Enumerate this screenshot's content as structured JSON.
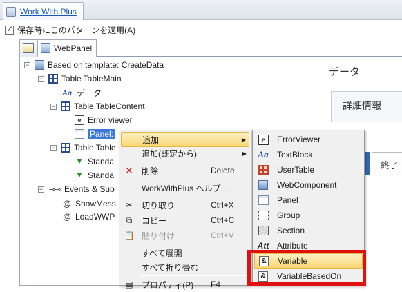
{
  "window": {
    "tab_title": "Work With Plus"
  },
  "option": {
    "label": "保存時にこのパターンを適用(A)",
    "checked": true
  },
  "inner_tabs": {
    "webpanel_label": "WebPanel"
  },
  "tree": [
    {
      "label": "Based on template: CreateData",
      "icon": "webpanel-icon",
      "expander": "−"
    },
    {
      "label": "Table TableMain",
      "icon": "table-icon",
      "expander": "−"
    },
    {
      "label": "データ",
      "icon": "textblock-icon",
      "expander": ""
    },
    {
      "label": "Table TableContent",
      "icon": "table-icon",
      "expander": "−"
    },
    {
      "label": "Error viewer",
      "icon": "errorviewer-icon",
      "expander": ""
    },
    {
      "label": "Panel:",
      "icon": "panel-icon",
      "expander": ""
    },
    {
      "label": "Table Table",
      "icon": "table-icon",
      "expander": "−"
    },
    {
      "label": "Standa",
      "icon": "standard-action-icon",
      "expander": ""
    },
    {
      "label": "Standa",
      "icon": "standard-action-icon",
      "expander": ""
    },
    {
      "label": "Events & Sub",
      "icon": "events-icon",
      "expander": "−"
    },
    {
      "label": "ShowMess",
      "icon": "at-icon",
      "expander": ""
    },
    {
      "label": "LoadWWP",
      "icon": "at-icon",
      "expander": ""
    }
  ],
  "right_panel": {
    "title": "データ",
    "section": "詳細情報",
    "end_button": "終了"
  },
  "context_menu": [
    {
      "label": "追加",
      "shortcut": "",
      "submenu": true,
      "highlighted": true,
      "icon": ""
    },
    {
      "label": "追加(既定から)",
      "shortcut": "",
      "submenu": true,
      "icon": ""
    },
    {
      "label": "削除",
      "shortcut": "Delete",
      "icon": "delete-icon"
    },
    {
      "label": "WorkWithPlus ヘルプ...",
      "shortcut": "",
      "icon": ""
    },
    {
      "label": "切り取り",
      "shortcut": "Ctrl+X",
      "icon": "cut-icon"
    },
    {
      "label": "コピー",
      "shortcut": "Ctrl+C",
      "icon": "copy-icon"
    },
    {
      "label": "貼り付け",
      "shortcut": "Ctrl+V",
      "disabled": true,
      "icon": "paste-icon"
    },
    {
      "label": "すべて展開",
      "shortcut": "",
      "icon": ""
    },
    {
      "label": "すべて折り畳む",
      "shortcut": "",
      "icon": ""
    },
    {
      "label": "プロパティ(P)",
      "shortcut": "F4",
      "icon": "properties-icon"
    }
  ],
  "submenu": [
    {
      "label": "ErrorViewer",
      "icon": "errorviewer-icon"
    },
    {
      "label": "TextBlock",
      "icon": "textblock-icon"
    },
    {
      "label": "UserTable",
      "icon": "usertable-icon"
    },
    {
      "label": "WebComponent",
      "icon": "webcomponent-icon"
    },
    {
      "label": "Panel",
      "icon": "panel-icon"
    },
    {
      "label": "Group",
      "icon": "group-icon"
    },
    {
      "label": "Section",
      "icon": "section-icon"
    },
    {
      "label": "Attribute",
      "icon": "attribute-icon"
    },
    {
      "label": "Variable",
      "icon": "variable-icon",
      "highlighted": true
    },
    {
      "label": "VariableBasedOn",
      "icon": "variable-based-on-icon"
    }
  ],
  "colors": {
    "selection": "#3b78d8",
    "highlight_box": "#e01010",
    "menu_hover": "#f7d774"
  }
}
